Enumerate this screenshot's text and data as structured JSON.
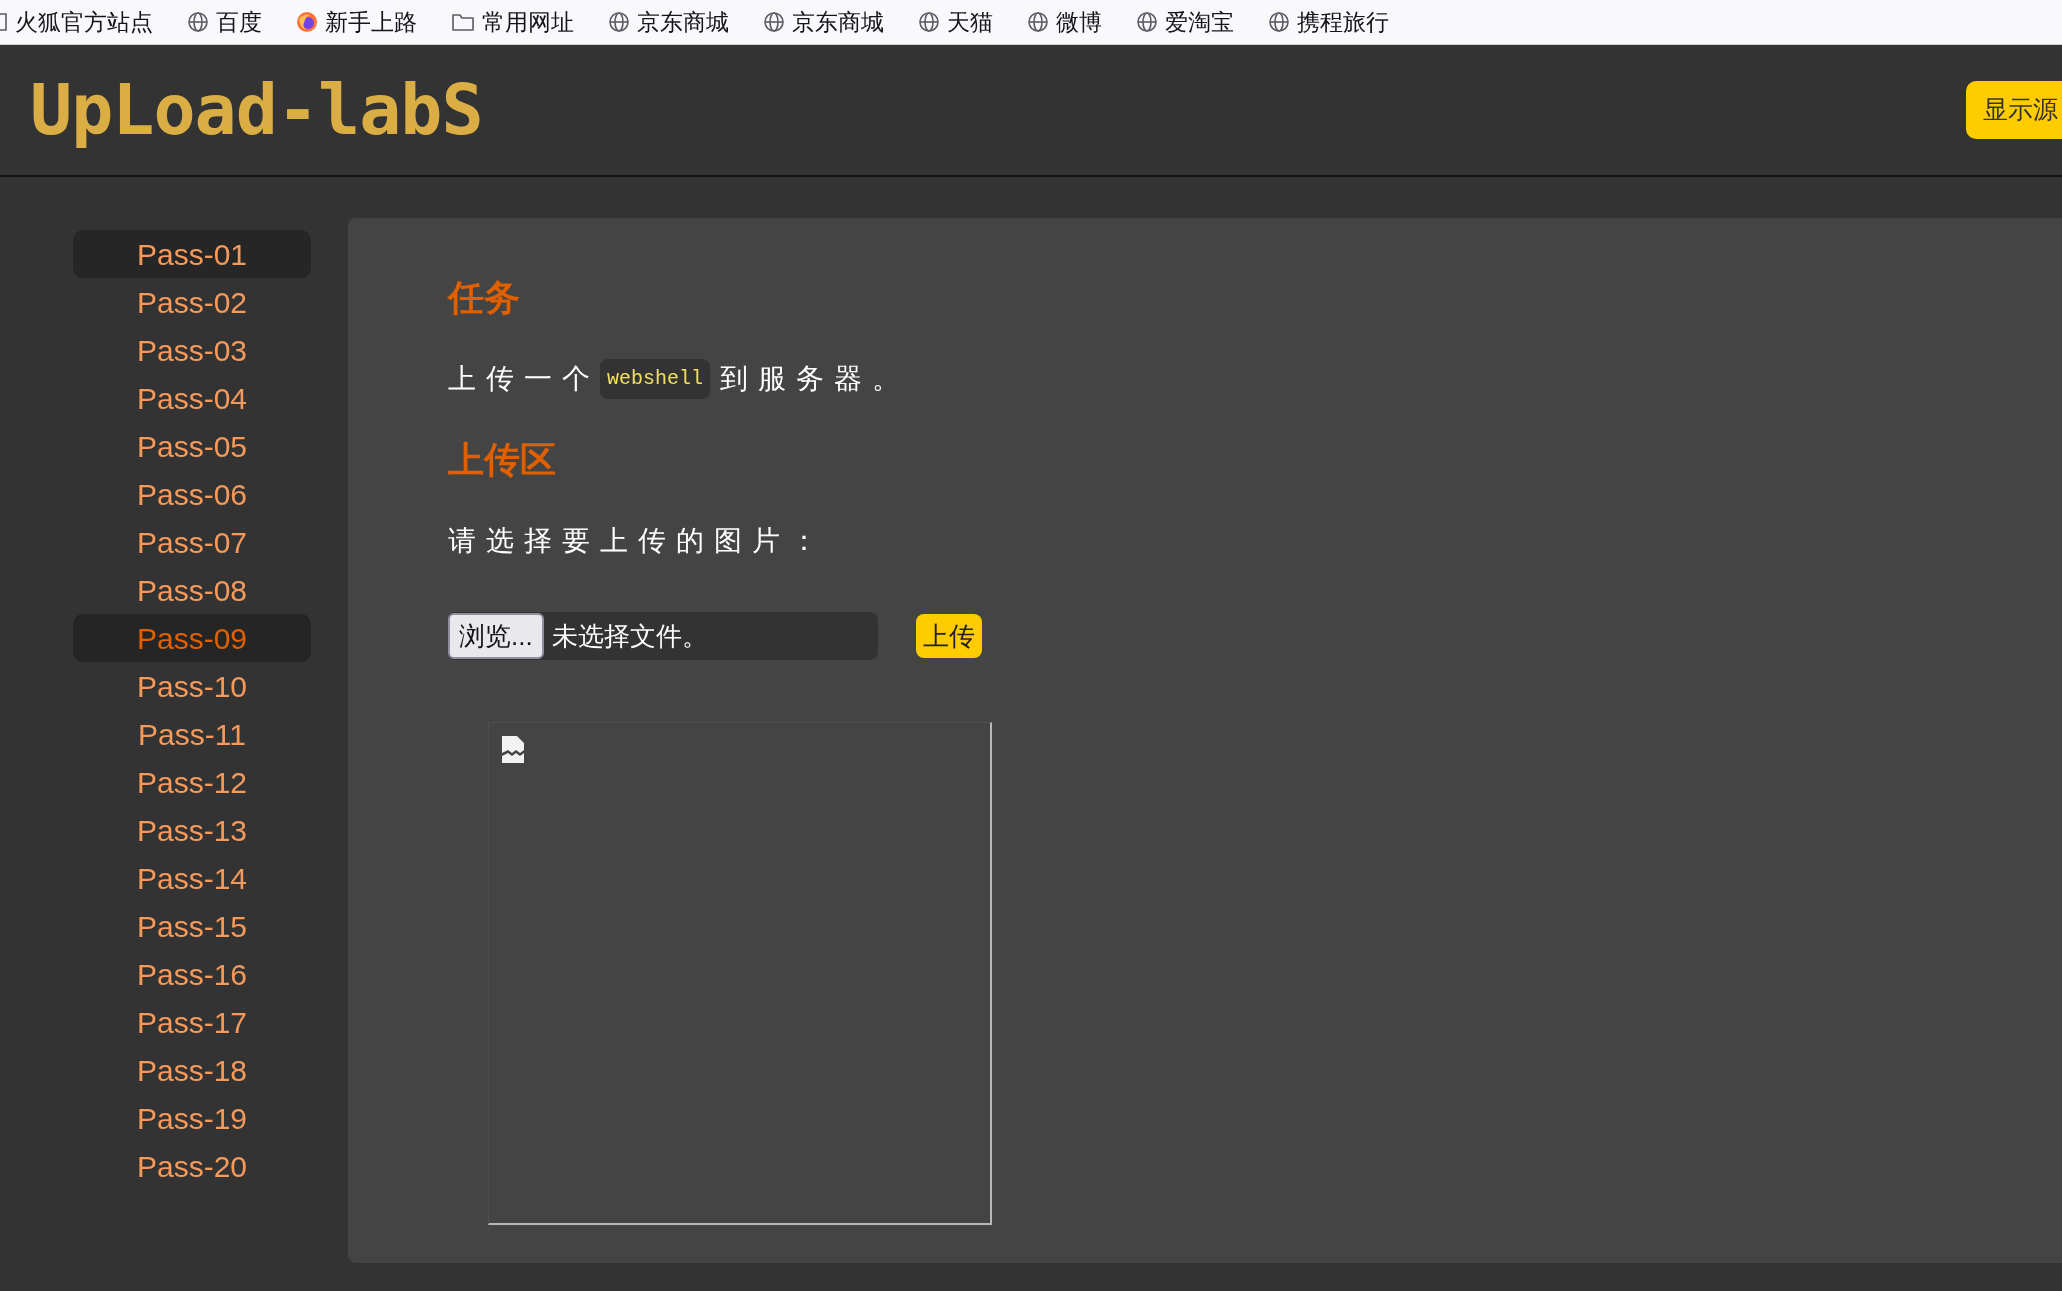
{
  "bookmarks": [
    {
      "label": "火狐官方站点",
      "kind": "page"
    },
    {
      "label": "百度",
      "kind": "site"
    },
    {
      "label": "新手上路",
      "kind": "browser"
    },
    {
      "label": "常用网址",
      "kind": "folder"
    },
    {
      "label": "京东商城",
      "kind": "site"
    },
    {
      "label": "京东商城",
      "kind": "site"
    },
    {
      "label": "天猫",
      "kind": "site"
    },
    {
      "label": "微博",
      "kind": "site"
    },
    {
      "label": "爱淘宝",
      "kind": "site"
    },
    {
      "label": "携程旅行",
      "kind": "site"
    }
  ],
  "header": {
    "logo": "UpLoad-labS",
    "source_button": "显示源"
  },
  "sidebar": {
    "items": [
      {
        "label": "Pass-01",
        "selected": false,
        "hovered": true
      },
      {
        "label": "Pass-02",
        "selected": false,
        "hovered": false
      },
      {
        "label": "Pass-03",
        "selected": false,
        "hovered": false
      },
      {
        "label": "Pass-04",
        "selected": false,
        "hovered": false
      },
      {
        "label": "Pass-05",
        "selected": false,
        "hovered": false
      },
      {
        "label": "Pass-06",
        "selected": false,
        "hovered": false
      },
      {
        "label": "Pass-07",
        "selected": false,
        "hovered": false
      },
      {
        "label": "Pass-08",
        "selected": false,
        "hovered": false
      },
      {
        "label": "Pass-09",
        "selected": true,
        "hovered": false
      },
      {
        "label": "Pass-10",
        "selected": false,
        "hovered": false
      },
      {
        "label": "Pass-11",
        "selected": false,
        "hovered": false
      },
      {
        "label": "Pass-12",
        "selected": false,
        "hovered": false
      },
      {
        "label": "Pass-13",
        "selected": false,
        "hovered": false
      },
      {
        "label": "Pass-14",
        "selected": false,
        "hovered": false
      },
      {
        "label": "Pass-15",
        "selected": false,
        "hovered": false
      },
      {
        "label": "Pass-16",
        "selected": false,
        "hovered": false
      },
      {
        "label": "Pass-17",
        "selected": false,
        "hovered": false
      },
      {
        "label": "Pass-18",
        "selected": false,
        "hovered": false
      },
      {
        "label": "Pass-19",
        "selected": false,
        "hovered": false
      },
      {
        "label": "Pass-20",
        "selected": false,
        "hovered": false
      }
    ]
  },
  "content": {
    "task_heading": "任务",
    "task_before": "上传一个",
    "task_code": "webshell",
    "task_after": "到服务器。",
    "upload_heading": "上传区",
    "upload_prompt": "请选择要上传的图片：",
    "file_input": {
      "button": "浏览...",
      "status": "未选择文件。"
    },
    "upload_button": "上传"
  }
}
